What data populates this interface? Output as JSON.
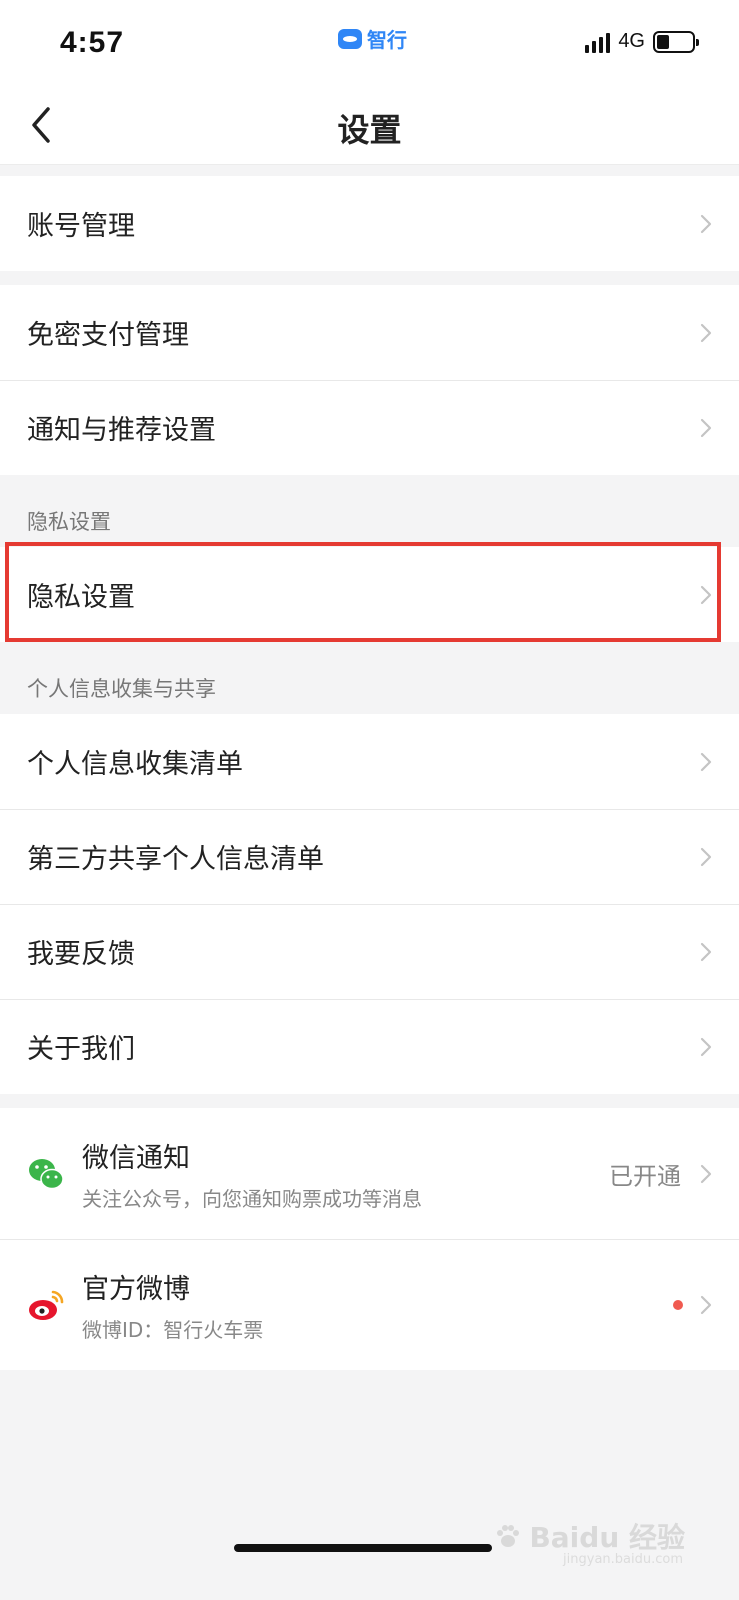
{
  "status_bar": {
    "time": "4:57",
    "app_name": "智行",
    "network": "4G"
  },
  "header": {
    "title": "设置",
    "back_icon": "chevron-left-icon"
  },
  "groups": {
    "account": [
      {
        "label": "账号管理"
      }
    ],
    "payment": [
      {
        "label": "免密支付管理"
      },
      {
        "label": "通知与推荐设置"
      }
    ],
    "privacy": {
      "section_label": "隐私设置",
      "items": [
        {
          "label": "隐私设置"
        }
      ]
    },
    "personal_info": {
      "section_label": "个人信息收集与共享",
      "items": [
        {
          "label": "个人信息收集清单"
        },
        {
          "label": "第三方共享个人信息清单"
        },
        {
          "label": "我要反馈"
        },
        {
          "label": "关于我们"
        }
      ]
    },
    "social": [
      {
        "icon": "wechat-icon",
        "title": "微信通知",
        "subtitle": "关注公众号，向您通知购票成功等消息",
        "status": "已开通"
      },
      {
        "icon": "weibo-icon",
        "title": "官方微博",
        "subtitle": "微博ID：智行火车票",
        "has_red_dot": true
      }
    ]
  },
  "annotation": {
    "highlight_color": "#e53a32"
  },
  "watermark": {
    "text": "Baidu 经验",
    "site": "jingyan.baidu.com"
  },
  "colors": {
    "accent": "#2f86f6",
    "wechat_green": "#3bb54a",
    "weibo_red": "#e6162d",
    "red_dot": "#f05a50"
  }
}
